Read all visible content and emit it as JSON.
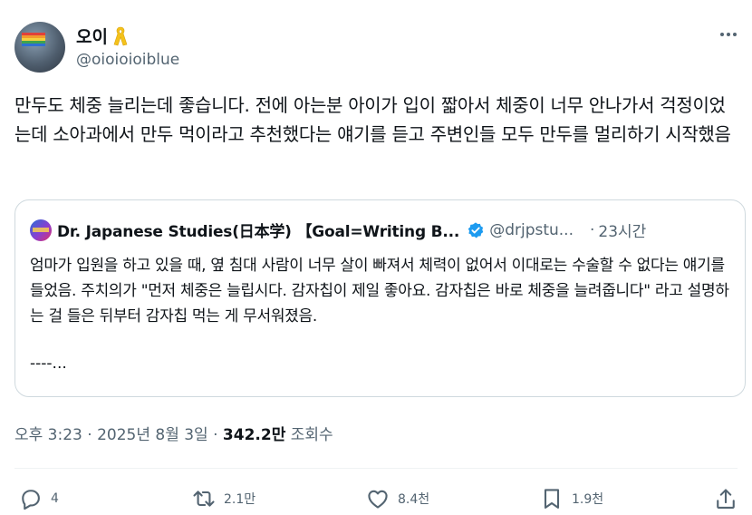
{
  "author": {
    "display_name": "오이",
    "badge_icon": "yellow-ribbon-icon",
    "handle": "@oioioioiblue",
    "more_icon": "more-horizontal-icon"
  },
  "tweet": {
    "text": "만두도 체중 늘리는데 좋습니다. 전에 아는분 아이가 입이 짧아서 체중이 너무 안나가서 걱정이었는데 소아과에서 만두 먹이라고 추천했다는 얘기를 듣고 주변인들 모두 만두를 멀리하기 시작했음"
  },
  "quote": {
    "name": "Dr. Japanese Studies(日本学) 【Goal=Writing B...",
    "verified_icon": "verified-badge-icon",
    "handle": "@drjpstu...",
    "separator": "·",
    "time": "23시간",
    "text": "엄마가 입원을 하고 있을 때, 옆 침대 사람이 너무 살이 빠져서 체력이 없어서 이대로는 수술할 수 없다는 얘기를 들었음. 주치의가 \"먼저 체중은 늘립시다. 감자칩이 제일 좋아요. 감자칩은 바로 체중을 늘려줍니다\" 라고 설명하는 걸 들은 뒤부터 감자칩 먹는 게 무서워졌음.",
    "more": "----..."
  },
  "meta": {
    "time": "오후 3:23",
    "sep1": " · ",
    "date": "2025년 8월 3일",
    "sep2": " · ",
    "views": "342.2만",
    "views_label": " 조회수"
  },
  "actions": {
    "reply_count": "4",
    "repost_count": "2.1만",
    "like_count": "8.4천",
    "bookmark_count": "1.9천"
  },
  "colors": {
    "text": "#0f1419",
    "secondary": "#536471",
    "border": "#cfd9de",
    "verified": "#1d9bf0",
    "ribbon": "#f4c21b"
  }
}
